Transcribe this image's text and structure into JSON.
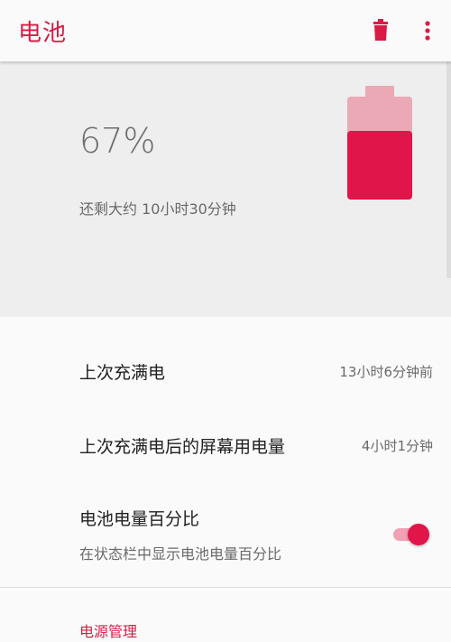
{
  "appbar": {
    "title": "电池",
    "delete_icon": "delete-icon",
    "more_icon": "more-vert-icon"
  },
  "battery": {
    "percent": "67%",
    "remaining": "还剩大约 10小时30分钟",
    "level": 0.67,
    "fill_color": "#e0164a",
    "empty_color": "#eba9b6"
  },
  "rows": {
    "last_full_charge": {
      "label": "上次充满电",
      "value": "13小时6分钟前"
    },
    "screen_usage": {
      "label": "上次充满电后的屏幕用电量",
      "value": "4小时1分钟"
    },
    "battery_percentage": {
      "label": "电池电量百分比",
      "summary": "在状态栏中显示电池电量百分比",
      "enabled": true
    }
  },
  "section": {
    "power_management": "电源管理"
  },
  "colors": {
    "accent": "#d81b45"
  }
}
